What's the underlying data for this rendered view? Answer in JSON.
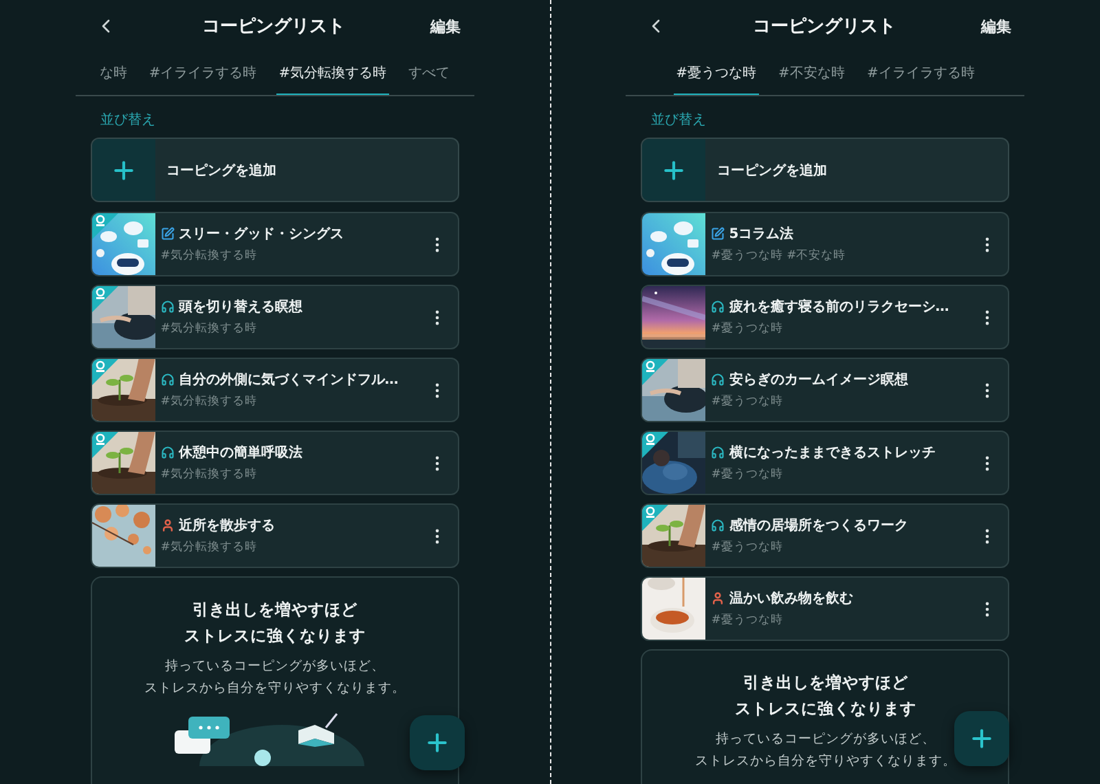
{
  "screens": [
    {
      "header": {
        "title": "コーピングリスト",
        "edit": "編集"
      },
      "tabs": [
        {
          "label": "な時",
          "selected": false
        },
        {
          "label": "#イライラする時",
          "selected": false
        },
        {
          "label": "#気分転換する時",
          "selected": true
        },
        {
          "label": "すべて",
          "selected": false
        }
      ],
      "sort": "並び替え",
      "add": "コーピングを追加",
      "items": [
        {
          "kind": "worksheet",
          "badge": true,
          "title": "スリー・グッド・シングス",
          "tags": "#気分転換する時"
        },
        {
          "kind": "audio",
          "badge": true,
          "title": "頭を切り替える瞑想",
          "tags": "#気分転換する時"
        },
        {
          "kind": "audio",
          "badge": true,
          "title": "自分の外側に気づくマインドフル…",
          "tags": "#気分転換する時"
        },
        {
          "kind": "audio",
          "badge": true,
          "title": "休憩中の簡単呼吸法",
          "tags": "#気分転換する時"
        },
        {
          "kind": "activity",
          "badge": false,
          "title": "近所を散歩する",
          "tags": "#気分転換する時"
        }
      ],
      "promo": {
        "title_lines": [
          "引き出しを増やすほど",
          "ストレスに強くなります"
        ],
        "body_lines": [
          "持っているコーピングが多いほど、",
          "ストレスから自分を守りやすくなります。"
        ],
        "illustration": true
      }
    },
    {
      "header": {
        "title": "コーピングリスト",
        "edit": "編集"
      },
      "tabs": [
        {
          "label": "#憂うつな時",
          "selected": true
        },
        {
          "label": "#不安な時",
          "selected": false
        },
        {
          "label": "#イライラする時",
          "selected": false
        }
      ],
      "sort": "並び替え",
      "add": "コーピングを追加",
      "items": [
        {
          "kind": "worksheet",
          "badge": false,
          "title": "5コラム法",
          "tags": "#憂うつな時 #不安な時"
        },
        {
          "kind": "audio",
          "badge": false,
          "title": "疲れを癒す寝る前のリラクセーシ…",
          "tags": "#憂うつな時"
        },
        {
          "kind": "audio",
          "badge": true,
          "title": "安らぎのカームイメージ瞑想",
          "tags": "#憂うつな時"
        },
        {
          "kind": "audio",
          "badge": true,
          "title": "横になったままできるストレッチ",
          "tags": "#憂うつな時"
        },
        {
          "kind": "audio",
          "badge": true,
          "title": "感情の居場所をつくるワーク",
          "tags": "#憂うつな時"
        },
        {
          "kind": "activity",
          "badge": false,
          "title": "温かい飲み物を飲む",
          "tags": "#憂うつな時"
        }
      ],
      "promo": {
        "title_lines": [
          "引き出しを増やすほど",
          "ストレスに強くなります"
        ],
        "body_lines": [
          "持っているコーピングが多いほど、",
          "ストレスから自分を守りやすくなります。"
        ]
      }
    }
  ]
}
